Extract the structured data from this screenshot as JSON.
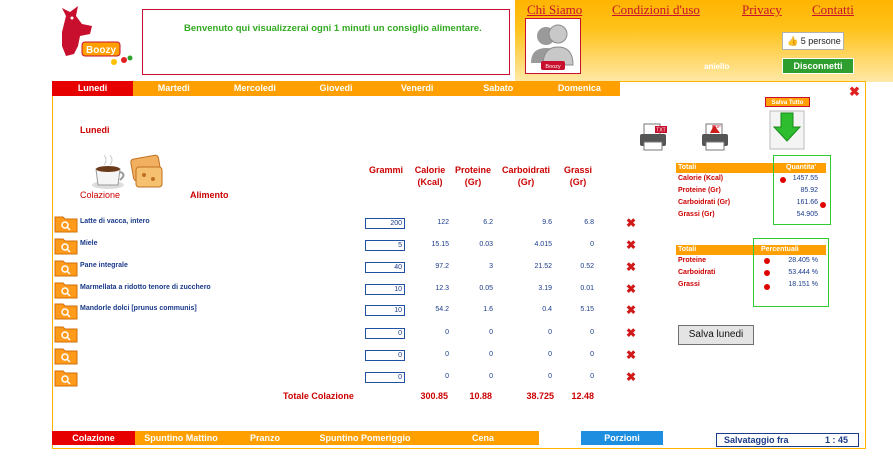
{
  "header": {
    "welcome_text": "Benvenuto qui visualizzerai ogni 1 minuti un consiglio alimentare.",
    "nav": [
      "Chi Siamo",
      "Condizioni d'uso",
      "Privacy",
      "Contatti"
    ],
    "like_label": "5 persone",
    "username": "aniello",
    "logout_label": "Disconnetti",
    "logo_text": "Boozy",
    "avatar_text": "Boozy"
  },
  "days": [
    "Lunedi",
    "Martedi",
    "Mercoledi",
    "Giovedi",
    "Venerdi",
    "Sabato",
    "Domenica"
  ],
  "active_day": "Lunedi",
  "day_title": "Lunedi",
  "meal": {
    "label": "Colazione",
    "food_column": "Alimento",
    "columns": [
      {
        "title": "Grammi",
        "unit": ""
      },
      {
        "title": "Calorie",
        "unit": "(Kcal)"
      },
      {
        "title": "Proteine",
        "unit": "(Gr)"
      },
      {
        "title": "Carboidrati",
        "unit": "(Gr)"
      },
      {
        "title": "Grassi",
        "unit": "(Gr)"
      }
    ],
    "rows": [
      {
        "name": "Latte di vacca, intero",
        "grams": "200",
        "kcal": "122",
        "prot": "6.2",
        "carb": "9.6",
        "fat": "6.8"
      },
      {
        "name": "Miele",
        "grams": "5",
        "kcal": "15.15",
        "prot": "0.03",
        "carb": "4.015",
        "fat": "0"
      },
      {
        "name": "Pane integrale",
        "grams": "40",
        "kcal": "97.2",
        "prot": "3",
        "carb": "21.52",
        "fat": "0.52"
      },
      {
        "name": "Marmellata a ridotto tenore di zucchero",
        "grams": "10",
        "kcal": "12.3",
        "prot": "0.05",
        "carb": "3.19",
        "fat": "0.01"
      },
      {
        "name": "Mandorle dolci [prunus communis]",
        "grams": "10",
        "kcal": "54.2",
        "prot": "1.6",
        "carb": "0.4",
        "fat": "5.15"
      },
      {
        "name": "",
        "grams": "0",
        "kcal": "0",
        "prot": "0",
        "carb": "0",
        "fat": "0"
      },
      {
        "name": "",
        "grams": "0",
        "kcal": "0",
        "prot": "0",
        "carb": "0",
        "fat": "0"
      },
      {
        "name": "",
        "grams": "0",
        "kcal": "0",
        "prot": "0",
        "carb": "0",
        "fat": "0"
      }
    ],
    "total_label": "Totale Colazione",
    "totals": {
      "kcal": "300.85",
      "prot": "10.88",
      "carb": "38.725",
      "fat": "12.48"
    }
  },
  "totals_panel": {
    "header": "Totali",
    "quantity_header": "Quantita'",
    "rows": [
      {
        "label": "Calorie (Kcal)",
        "value": "1457.55"
      },
      {
        "label": "Proteine (Gr)",
        "value": "85.92"
      },
      {
        "label": "Carboidrati (Gr)",
        "value": "161.66"
      },
      {
        "label": "Grassi (Gr)",
        "value": "54.905"
      }
    ]
  },
  "percent_panel": {
    "header": "Totali",
    "percent_header": "Percentuali",
    "rows": [
      {
        "label": "Proteine",
        "value": "28.405 %"
      },
      {
        "label": "Carboidrati",
        "value": "53.444 %"
      },
      {
        "label": "Grassi",
        "value": "18.151 %"
      }
    ]
  },
  "export": {
    "txt": "TXT",
    "pdf": "PDF",
    "save_all": "Salva Tutto"
  },
  "save_day_label": "Salva lunedi",
  "meal_tabs": [
    "Colazione",
    "Spuntino Mattino",
    "Pranzo",
    "Spuntino Pomeriggio",
    "Cena"
  ],
  "portions_label": "Porzioni",
  "save_timer": {
    "label": "Salvataggio fra",
    "value": "1 :  45"
  },
  "colors": {
    "orange": "#ffa000",
    "red": "#e60000",
    "blue": "#1e8fe0",
    "green": "#2e9e2e",
    "navy": "#1a3a8a"
  }
}
